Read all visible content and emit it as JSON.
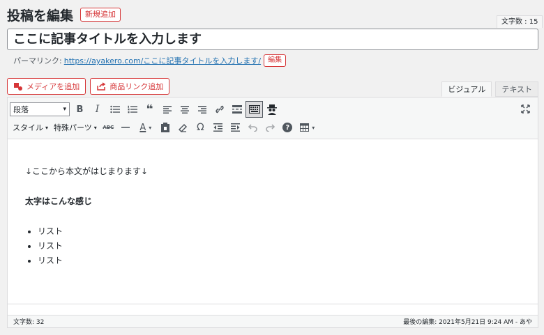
{
  "header": {
    "title": "投稿を編集",
    "new_post": "新規追加"
  },
  "char_count_top": "文字数 : 15",
  "post_title": "ここに記事タイトルを入力します",
  "permalink": {
    "label": "パーマリンク:",
    "url": "https://ayakero.com/ここに記事タイトルを入力します/",
    "edit": "編集"
  },
  "media": {
    "add_media": "メディアを追加",
    "add_product": "商品リンク追加"
  },
  "tabs": {
    "visual": "ビジュアル",
    "text": "テキスト"
  },
  "toolbar": {
    "format": "段落",
    "style_menu": "スタイル",
    "parts_menu": "特殊パーツ",
    "strike": "ABC",
    "bold": "B",
    "italic": "I",
    "quote": "❝",
    "omega": "Ω",
    "text_color": "A",
    "help": "?",
    "caret": "▾"
  },
  "body": {
    "line1": "↓ここから本文がはじまります↓",
    "line2": "太字はこんな感じ",
    "list": [
      "リスト",
      "リスト",
      "リスト"
    ]
  },
  "status": {
    "word_count": "文字数: 32",
    "last_edit": "最後の編集: 2021年5月21日 9:24 AM - あや"
  },
  "colors": {
    "accent": "#d63638",
    "link": "#2271b1"
  }
}
